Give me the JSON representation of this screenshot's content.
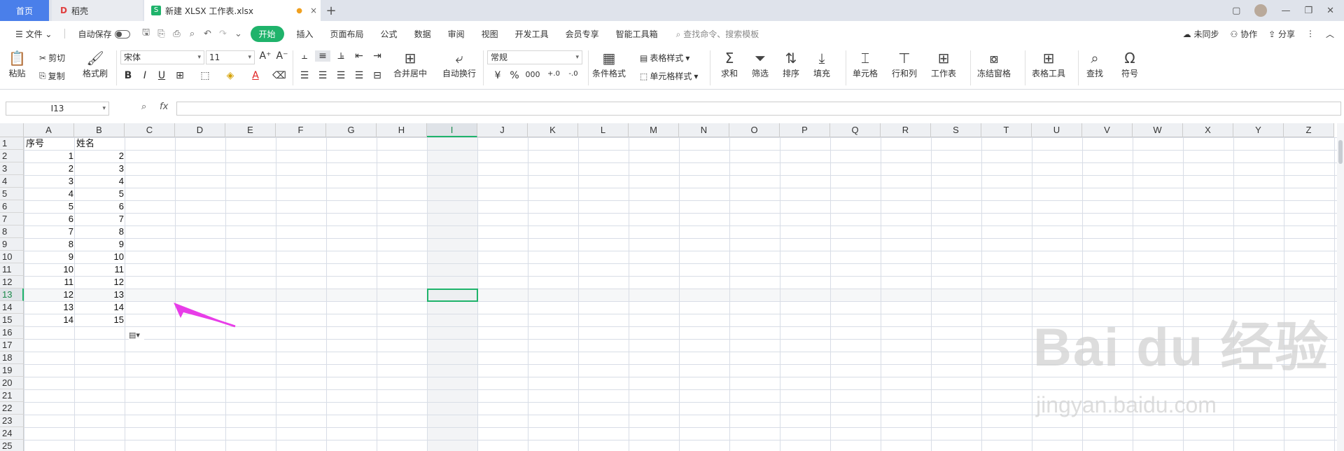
{
  "tabs": {
    "home": "首页",
    "docer": "稻壳",
    "file": "新建 XLSX 工作表.xlsx",
    "add": "+"
  },
  "menubar": {
    "file": "文件",
    "autosave": "自动保存",
    "start": "开始",
    "items": [
      "插入",
      "页面布局",
      "公式",
      "数据",
      "审阅",
      "视图",
      "开发工具",
      "会员专享",
      "智能工具箱"
    ],
    "search_placeholder": "查找命令、搜索模板",
    "sync": "未同步",
    "collab": "协作",
    "share": "分享"
  },
  "ribbon": {
    "paste": "粘贴",
    "cut": "剪切",
    "copy": "复制",
    "format_painter": "格式刷",
    "font_name": "宋体",
    "font_size": "11",
    "merge_center": "合并居中",
    "wrap_text": "自动换行",
    "number_format": "常规",
    "table_style": "表格样式",
    "conditional_format": "条件格式",
    "cell_style": "单元格样式",
    "sum": "求和",
    "filter": "筛选",
    "sort": "排序",
    "fill": "填充",
    "cell": "单元格",
    "row_col": "行和列",
    "worksheet": "工作表",
    "freeze": "冻结窗格",
    "table_tools": "表格工具",
    "find": "查找",
    "symbol": "符号"
  },
  "formula_bar": {
    "name_box": "I13",
    "fx": "fx",
    "value": ""
  },
  "sheet": {
    "columns": [
      "A",
      "B",
      "C",
      "D",
      "E",
      "F",
      "G",
      "H",
      "I",
      "J",
      "K",
      "L",
      "M",
      "N",
      "O",
      "P",
      "Q",
      "R",
      "S",
      "T",
      "U",
      "V",
      "W",
      "X",
      "Y",
      "Z"
    ],
    "rows": [
      "1",
      "2",
      "3",
      "4",
      "5",
      "6",
      "7",
      "8",
      "9",
      "10",
      "11",
      "12",
      "13",
      "14",
      "15",
      "16",
      "17",
      "18",
      "19",
      "20",
      "21",
      "22",
      "23",
      "24",
      "25"
    ],
    "selected_cell": "I13",
    "header_a": "序号",
    "header_b": "姓名",
    "col_a": [
      "1",
      "2",
      "3",
      "4",
      "5",
      "6",
      "7",
      "8",
      "9",
      "10",
      "11",
      "12",
      "13",
      "14"
    ],
    "col_b": [
      "2",
      "3",
      "4",
      "5",
      "6",
      "7",
      "8",
      "9",
      "10",
      "11",
      "12",
      "13",
      "14",
      "15"
    ]
  },
  "watermark": {
    "brand": "Bai du 经验",
    "url": "jingyan.baidu.com"
  },
  "colors": {
    "accent": "#1fb36b",
    "home_tab": "#4a7fea",
    "annotation_arrow": "#e83de8"
  }
}
